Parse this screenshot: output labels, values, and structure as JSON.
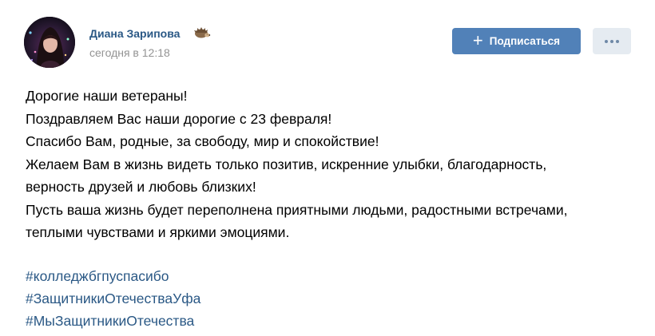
{
  "author": {
    "name": "Диана Зарипова",
    "badge_icon": "hedgehog-icon",
    "post_time": "сегодня в 12:18",
    "avatar": "avatar-photo"
  },
  "actions": {
    "subscribe_label": "Подписаться",
    "subscribe_icon": "plus-icon",
    "more_icon": "more-dots-icon"
  },
  "post": {
    "lines": [
      "Дорогие наши ветераны!",
      "Поздравляем Вас наши дорогие с 23 февраля!",
      "Спасибо Вам, родные, за свободу, мир и спокойствие!",
      "Желаем Вам в жизнь видеть только позитив, искренние улыбки, благодарность,",
      "верность друзей и любовь близких!",
      "Пусть ваша жизнь будет переполнена приятными людьми, радостными встречами,",
      "теплыми чувствами и яркими эмоциями."
    ],
    "hashtags": [
      "#колледжбгпуспасибо",
      "#ЗащитникиОтечестваУфа",
      "#МыЗащитникиОтечества"
    ]
  },
  "colors": {
    "link": "#2a5885",
    "button_primary": "#5181b8",
    "button_secondary": "#e5ebf1",
    "meta_text": "#939393"
  }
}
